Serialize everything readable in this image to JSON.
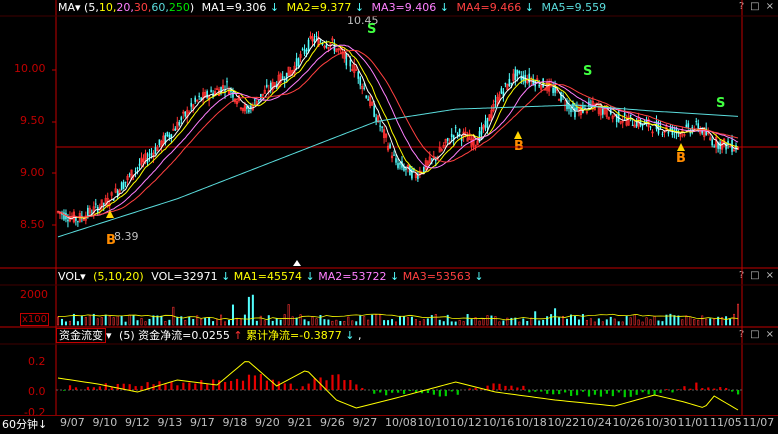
{
  "price_header": {
    "indicator": "MA",
    "params_prefix": "(",
    "p1": "5,",
    "p2": "10,",
    "p3": "20,",
    "p4": "30,",
    "p5": "60,",
    "p6": "250",
    "params_suffix": ")",
    "ma1": "MA1=9.306",
    "ma2": "MA2=9.377",
    "ma3": "MA3=9.406",
    "ma4": "MA4=9.466",
    "ma5": "MA5=9.559",
    "down_arrow": "↓"
  },
  "vol_header": {
    "indicator": "VOL",
    "params": "(5,10,20)",
    "vol": "VOL=32971",
    "ma1": "MA1=45574",
    "ma2": "MA2=53722",
    "ma3": "MA3=53563",
    "down_arrow": "↓"
  },
  "flow_header": {
    "indicator": "资金流变",
    "params": "(5)",
    "net": "资金净流=0.0255",
    "cum": "累计净流=-0.3877",
    "up_arrow": "↑",
    "down_arrow": "↓",
    "tail": ","
  },
  "tools": {
    "help": "?",
    "maximize": "□",
    "close": "×"
  },
  "price_axis": [
    "10.00",
    "9.50",
    "9.00",
    "8.50"
  ],
  "vol_axis": [
    "2000",
    "x100"
  ],
  "flow_axis": [
    "0.2",
    "0.0",
    "-0.2"
  ],
  "period_label": "60分钟",
  "x_labels": [
    "9/07",
    "9/10",
    "9/12",
    "9/13",
    "9/17",
    "9/18",
    "9/20",
    "9/21",
    "9/26",
    "9/27",
    "10/08",
    "10/10",
    "10/12",
    "10/16",
    "10/18",
    "10/22",
    "10/24",
    "10/26",
    "10/30",
    "11/01",
    "11/05",
    "11/07"
  ],
  "annotations": {
    "high": "10.45",
    "low": "8.39",
    "sell": "S",
    "buy": "B"
  },
  "colors": {
    "up": "#ff3232",
    "down": "#54ffff",
    "ma1": "#ffffff",
    "ma2": "#ffff00",
    "ma3": "#ff80ff",
    "ma4": "#00e600",
    "ma5": "#5adcdc",
    "axis": "#c00000"
  }
}
